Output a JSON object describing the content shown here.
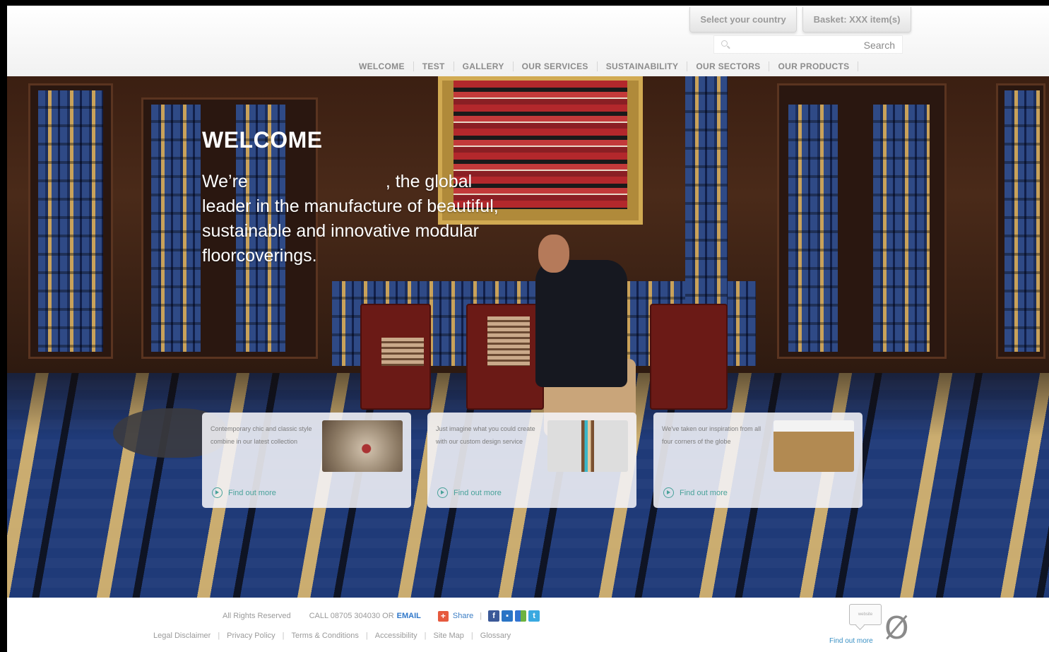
{
  "header": {
    "country_button": "Select your country",
    "basket_button": "Basket: XXX item(s)",
    "search": {
      "value": "",
      "placeholder": "",
      "label": "Search"
    },
    "nav": [
      "WELCOME",
      "TEST",
      "GALLERY",
      "OUR SERVICES",
      "SUSTAINABILITY",
      "OUR SECTORS",
      "OUR PRODUCTS"
    ]
  },
  "hero": {
    "title": "WELCOME",
    "line1_before": "We’re",
    "line1_after": ", the global",
    "line2": "leader in the manufacture of beautiful,",
    "line3": "sustainable and innovative modular",
    "line4": "floorcoverings."
  },
  "promos": [
    {
      "text": "Contemporary chic and classic style combine in our latest collection",
      "link": "Find out more"
    },
    {
      "text": "Just imagine what you could create with our custom design service",
      "link": "Find out more"
    },
    {
      "text": "We've taken our inspiration from all four corners of the globe",
      "link": "Find out more"
    }
  ],
  "footer": {
    "rights": "All Rights Reserved",
    "call": "CALL 08705 304030 OR",
    "email": "EMAIL",
    "share": "Share",
    "social_icons": [
      "facebook-icon",
      "flickr-icon",
      "delicious-icon",
      "twitter-icon"
    ],
    "links": [
      "Legal Disclaimer",
      "Privacy Policy",
      "Terms & Conditions",
      "Accessibility",
      "Site Map",
      "Glossary"
    ],
    "badge_bubble": "website",
    "badge_link": "Find out more",
    "badge_glyph": "Ø"
  },
  "colors": {
    "accent_teal": "#49a29a",
    "link_blue": "#2f77c9",
    "share_orange": "#e65a3e"
  }
}
